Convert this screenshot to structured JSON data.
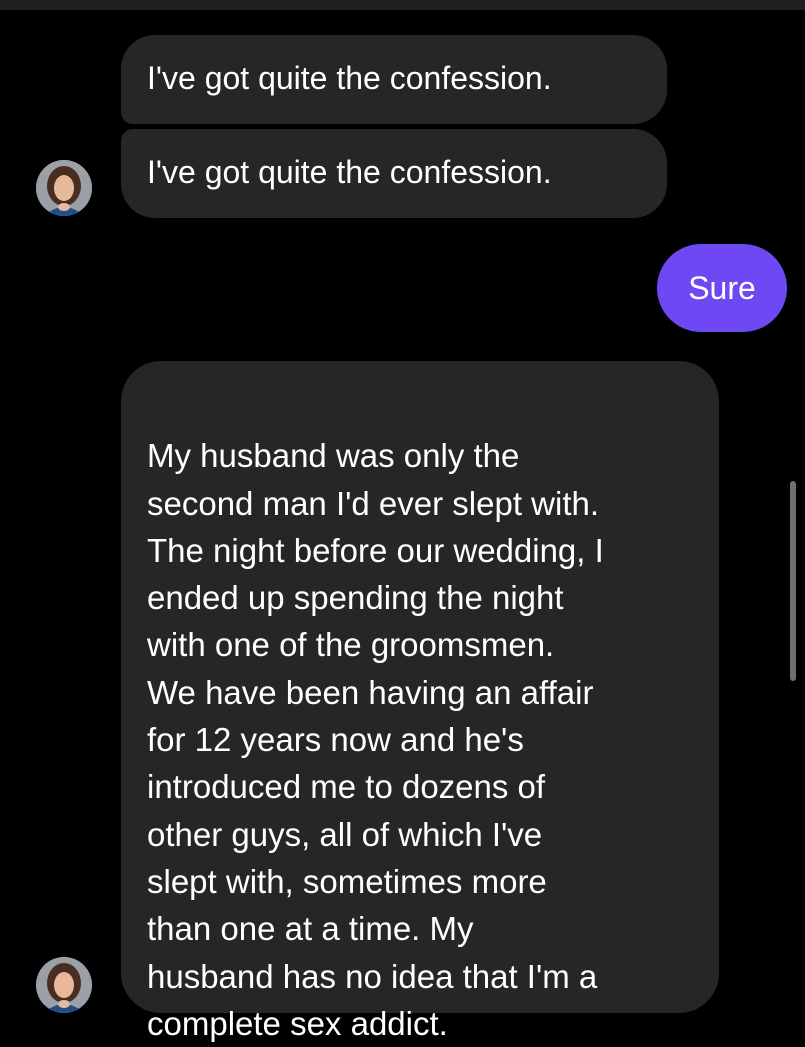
{
  "messages": [
    {
      "text": "I've got quite the confession."
    },
    {
      "text": "I've got quite the confession."
    },
    {
      "text": "Sure"
    },
    {
      "text": "My husband was only the\nsecond man I'd ever slept with.\nThe night before our wedding, I\nended up spending the night\nwith one of the groomsmen.\nWe have been having an affair\nfor 12 years now and he's\nintroduced me to dozens of\nother guys, all of which I've\nslept with, sometimes more\nthan one at a time. My\nhusband has no idea that I'm a\ncomplete sex addict."
    }
  ],
  "colors": {
    "background": "#000000",
    "received_bubble": "#262626",
    "sent_bubble": "#6e48f2",
    "text": "#ffffff"
  },
  "icons": {
    "avatar": "contact-avatar-photo"
  }
}
